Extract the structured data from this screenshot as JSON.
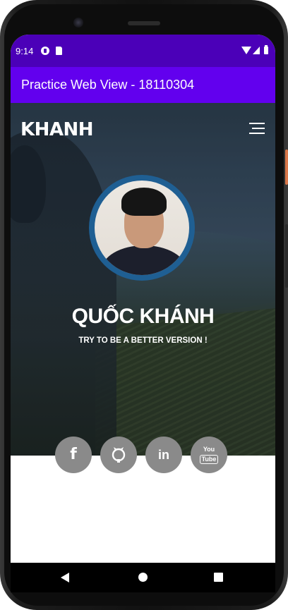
{
  "status_bar": {
    "time": "9:14",
    "icons": [
      "notification-icon",
      "sd-card-icon",
      "wifi-icon",
      "signal-icon",
      "battery-icon"
    ]
  },
  "app_bar": {
    "title": "Practice Web View - 18110304",
    "background": "#6200ee",
    "status_background": "#4b00b8"
  },
  "site": {
    "logo": "KHANH",
    "menu_icon": "hamburger-menu-icon",
    "profile": {
      "name": "QUỐC KHÁNH",
      "tagline": "TRY TO BE A BETTER VERSION !",
      "avatar_ring_color": "#1f5f93"
    },
    "social": [
      {
        "name": "facebook-icon",
        "glyph": "f"
      },
      {
        "name": "github-icon",
        "glyph": ""
      },
      {
        "name": "linkedin-icon",
        "glyph": "in"
      },
      {
        "name": "youtube-icon",
        "glyph_top": "You",
        "glyph_bottom": "Tube"
      }
    ],
    "social_button_color": "#8a8a8a"
  },
  "nav_bar": {
    "buttons": [
      "back-icon",
      "home-icon",
      "recents-icon"
    ]
  }
}
